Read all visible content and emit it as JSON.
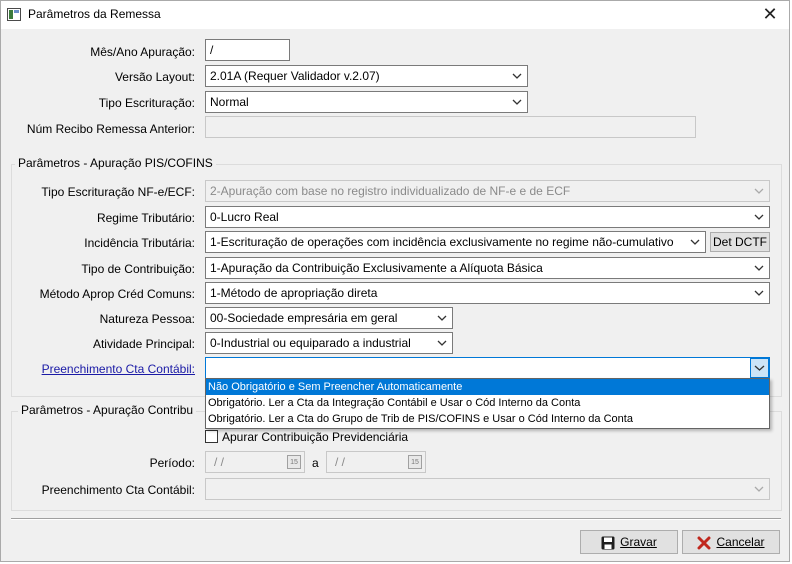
{
  "window": {
    "title": "Parâmetros da Remessa",
    "close_glyph": "✕"
  },
  "fields": {
    "mes_ano": {
      "label": "Mês/Ano Apuração:",
      "value": " /"
    },
    "versao_layout": {
      "label": "Versão Layout:",
      "value": "2.01A (Requer Validador v.2.07)"
    },
    "tipo_escrituracao": {
      "label": "Tipo Escrituração:",
      "value": "Normal"
    },
    "num_recibo": {
      "label": "Núm Recibo Remessa Anterior:",
      "value": ""
    }
  },
  "pis_cofins": {
    "title": "Parâmetros - Apuração PIS/COFINS",
    "tipo_escrit_nfe": {
      "label": "Tipo Escrituração NF-e/ECF:",
      "value": "2-Apuração com base no registro individualizado de NF-e e de ECF"
    },
    "regime": {
      "label": "Regime Tributário:",
      "value": "0-Lucro Real"
    },
    "incidencia": {
      "label": "Incidência Tributária:",
      "value": "1-Escrituração de operações com incidência exclusivamente no regime não-cumulativo",
      "button": "Det DCTF"
    },
    "tipo_contrib": {
      "label": "Tipo de Contribuição:",
      "value": "1-Apuração da Contribuição Exclusivamente a Alíquota Básica"
    },
    "metodo": {
      "label": "Método Aprop Créd Comuns:",
      "value": "1-Método de apropriação direta"
    },
    "natureza": {
      "label": "Natureza Pessoa:",
      "value": "00-Sociedade empresária em geral"
    },
    "atividade": {
      "label": "Atividade Principal:",
      "value": "0-Industrial ou equiparado a industrial"
    },
    "preench": {
      "label": "Preenchimento Cta Contábil:",
      "value": ""
    },
    "preench_options": [
      "Não Obrigatório e Sem Preencher Automaticamente",
      "Obrigatório. Ler a Cta da Integração Contábil e Usar o Cód Interno da Conta",
      "Obrigatório. Ler a Cta do Grupo de Trib de PIS/COFINS e Usar o Cód Interno da Conta"
    ]
  },
  "previd": {
    "title": "Parâmetros - Apuração Contribu",
    "apurar_label": "Apurar Contribuição Previdenciária",
    "periodo_label": "Período:",
    "periodo_from": "/ /",
    "periodo_sep": "a",
    "periodo_to": "/ /",
    "cal_icon_text": "15",
    "preench_label": "Preenchimento Cta Contábil:"
  },
  "buttons": {
    "gravar": "Gravar",
    "cancelar": "Cancelar"
  },
  "colors": {
    "accent": "#0078d7",
    "link": "#1a1aa6",
    "cancel_icon": "#c0281e"
  }
}
